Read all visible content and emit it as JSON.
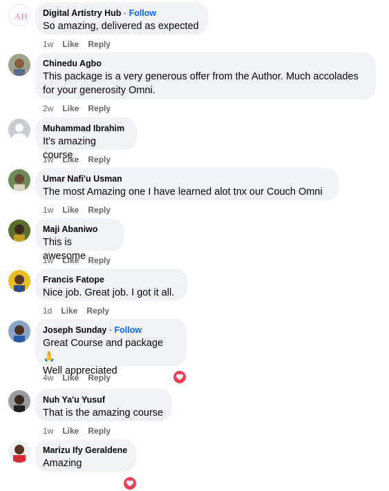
{
  "comments": [
    {
      "name": "Digital Artistry Hub",
      "follow": "Follow",
      "text": "So amazing, delivered as expected",
      "time": "1w",
      "like": "Like",
      "reply": "Reply"
    },
    {
      "name": "Chinedu Agbo",
      "text": "This package is a very generous offer from the Author. Much accolades",
      "text2": "for your generosity Omni.",
      "time": "2w",
      "like": "Like",
      "reply": "Reply"
    },
    {
      "name": "Muhammad Ibrahim",
      "text": "It's amazing course",
      "time": "1w",
      "like": "Like",
      "reply": "Reply"
    },
    {
      "name": "Umar Nafi'u Usman",
      "text": "The most Amazing one I have learned alot tnx our Couch Omni",
      "time": "1w",
      "like": "Like",
      "reply": "Reply"
    },
    {
      "name": "Maji Abaniwo",
      "text": "This is awesome",
      "time": "1w",
      "like": "Like",
      "reply": "Reply"
    },
    {
      "name": "Francis Fatope",
      "text": "Nice job. Great job. I got it all.",
      "time": "1d",
      "like": "Like",
      "reply": "Reply"
    },
    {
      "name": "Joseph Sunday",
      "follow": "Follow",
      "text": "Great Course and package 🙏",
      "text2": "Well appreciated",
      "time": "4w",
      "like": "Like",
      "reply": "Reply"
    },
    {
      "name": "Nuh Ya'u Yusuf",
      "text": "That is the amazing course",
      "time": "1w",
      "like": "Like",
      "reply": "Reply"
    },
    {
      "name": "Marizu Ify Geraldene",
      "text": "Amazing",
      "time": "",
      "like": "",
      "reply": ""
    }
  ],
  "reaction_icon": "heart-icon",
  "colors": {
    "bubble": "#f0f2f5",
    "follow": "#0866ff",
    "meta": "#65676b",
    "heart": "#f33e58"
  }
}
